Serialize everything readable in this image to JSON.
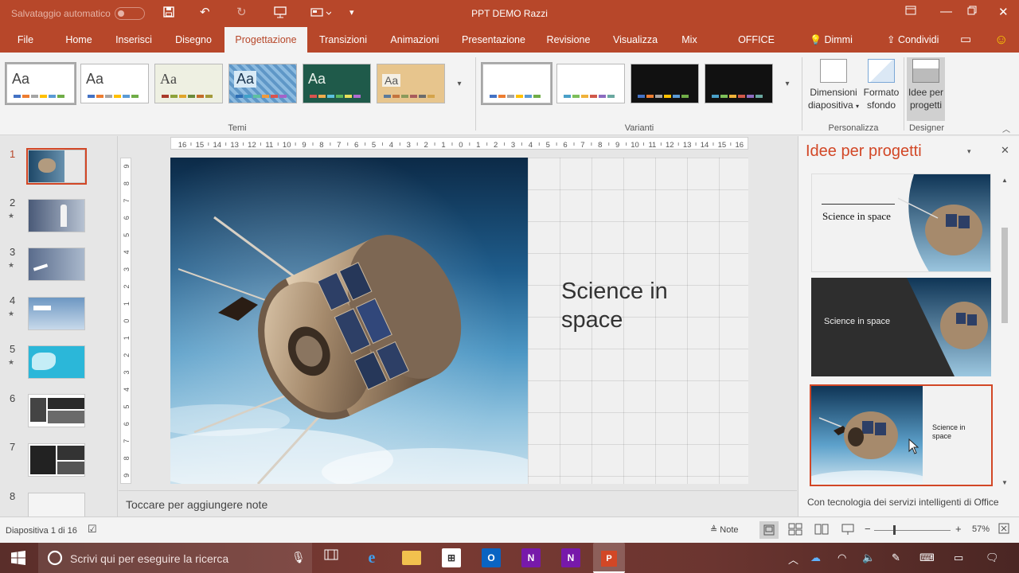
{
  "titlebar": {
    "autosave_label": "Salvataggio automatico",
    "title": "PPT DEMO Razzi"
  },
  "tabs": [
    {
      "label": "File"
    },
    {
      "label": "Home"
    },
    {
      "label": "Inserisci"
    },
    {
      "label": "Disegno"
    },
    {
      "label": "Progettazione",
      "active": true
    },
    {
      "label": "Transizioni"
    },
    {
      "label": "Animazioni"
    },
    {
      "label": "Presentazione"
    },
    {
      "label": "Revisione"
    },
    {
      "label": "Visualizza"
    },
    {
      "label": "Mix"
    },
    {
      "label": "OFFICE REMOTE"
    }
  ],
  "tell_me": "Dimmi",
  "share": "Condividi",
  "ribbon": {
    "themes_group": "Temi",
    "variants_group": "Varianti",
    "customize_group": "Personalizza",
    "designer_group": "Designer",
    "theme_glyph": "Aa",
    "slide_size_l1": "Dimensioni",
    "slide_size_l2": "diapositiva",
    "format_bg_l1": "Formato",
    "format_bg_l2": "sfondo",
    "design_ideas_l1": "Idee per",
    "design_ideas_l2": "progetti"
  },
  "ruler": {
    "h_ticks": [
      "16",
      "15",
      "14",
      "13",
      "12",
      "11",
      "10",
      "9",
      "8",
      "7",
      "6",
      "5",
      "4",
      "3",
      "2",
      "1",
      "0",
      "1",
      "2",
      "3",
      "4",
      "5",
      "6",
      "7",
      "8",
      "9",
      "10",
      "11",
      "12",
      "13",
      "14",
      "15",
      "16"
    ],
    "v_ticks": [
      "9",
      "8",
      "7",
      "6",
      "5",
      "4",
      "3",
      "2",
      "1",
      "0",
      "1",
      "2",
      "3",
      "4",
      "5",
      "6",
      "7",
      "8",
      "9"
    ]
  },
  "slides": [
    {
      "num": "1",
      "star": ""
    },
    {
      "num": "2",
      "star": "★"
    },
    {
      "num": "3",
      "star": "★"
    },
    {
      "num": "4",
      "star": "★"
    },
    {
      "num": "5",
      "star": "★"
    },
    {
      "num": "6",
      "star": ""
    },
    {
      "num": "7",
      "star": ""
    },
    {
      "num": "8",
      "star": ""
    }
  ],
  "slide": {
    "title": "Science in space"
  },
  "notes_placeholder": "Toccare per aggiungere note",
  "designer": {
    "title": "Idee per progetti",
    "design1_text": "Science in space",
    "design2_text": "Science in space",
    "design3_text": "Science in space",
    "footer": "Con tecnologia dei servizi intelligenti di Office"
  },
  "status": {
    "slide_counter": "Diapositiva 1 di 16",
    "notes_label": "Note",
    "zoom_pct": "57%",
    "zoom_level": 0.57
  },
  "taskbar": {
    "search_placeholder": "Scrivi qui per eseguire la ricerca"
  },
  "colors": {
    "accent": "#b7472a",
    "accent_highlight": "#d24726"
  }
}
